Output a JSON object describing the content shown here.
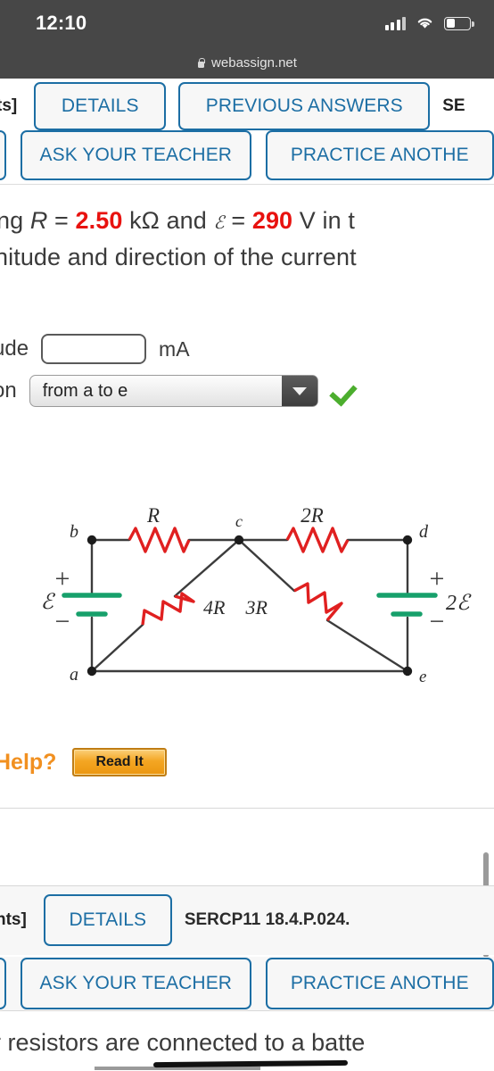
{
  "status_bar": {
    "time": "12:10",
    "signal_icon": "cellular-signal-icon",
    "wifi_icon": "wifi-icon",
    "battery_icon": "battery-icon"
  },
  "browser": {
    "lock_icon": "lock-icon",
    "host": "webassign.net"
  },
  "question_top": {
    "points_label": "ts]",
    "details_label": "DETAILS",
    "previous_answers_label": "PREVIOUS ANSWERS",
    "send_label": "SE",
    "ask_teacher_label": "ASK YOUR TEACHER",
    "practice_label": "PRACTICE ANOTHE"
  },
  "question_body": {
    "line1_pre": "ng ",
    "line1_R": "R",
    "line1_eq1": " = ",
    "line1_val1": "2.50",
    "line1_unit1": " kΩ and ",
    "line1_emf": "ℰ",
    "line1_eq2": " = ",
    "line1_val2": "290",
    "line1_post": " V in t",
    "line2": "nitude and direction of the current",
    "magnitude_label": "ude",
    "magnitude_value": "",
    "magnitude_unit": "mA",
    "direction_label": "on",
    "direction_value": "from a to e",
    "direction_options": [
      "from a to e"
    ],
    "correct_icon": "green-checkmark-icon"
  },
  "circuit": {
    "nodes": [
      "a",
      "b",
      "c",
      "d",
      "e"
    ],
    "resistors": [
      "R",
      "2R",
      "4R",
      "3R"
    ],
    "batteries": [
      {
        "label": "ℰ",
        "plus": "+",
        "minus": "−"
      },
      {
        "label": "2ℰ",
        "plus": "+",
        "minus": "−"
      }
    ],
    "resistor_color": "#e02020",
    "battery_color": "#17a06b",
    "wire_color": "#3c3c3c"
  },
  "need_help": {
    "label": "Help?",
    "read_it_label": "Read It"
  },
  "question_bottom": {
    "points_label": "nts]",
    "details_label": "DETAILS",
    "code": "SERCP11 18.4.P.024.",
    "ask_teacher_label": "ASK YOUR TEACHER",
    "practice_label": "PRACTICE ANOTHE",
    "text": "r resistors are connected to a batte"
  },
  "colors": {
    "accent_blue": "#1c6ea4",
    "red_value": "#e8120f",
    "orange_help": "#f19020",
    "green_check": "#4cae2e"
  }
}
